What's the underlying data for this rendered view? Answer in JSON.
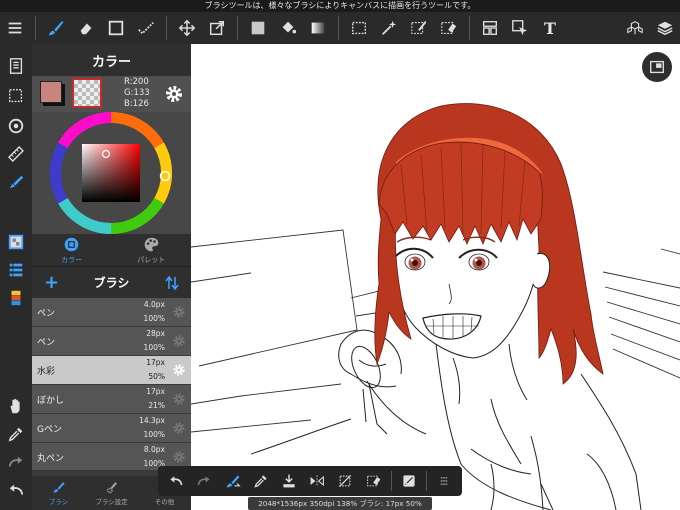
{
  "status_message": "ブラシツールは、様々なブラシによりキャンバスに描画を行うツールです。",
  "toolbar": {
    "left_tools": [
      "menu-icon",
      "brush-icon",
      "eraser-icon",
      "rectangle-icon",
      "dot-brush-icon"
    ],
    "mid_tools": [
      "move-icon",
      "transform-icon",
      "fill-swatch-icon",
      "bucket-icon",
      "gradient-icon"
    ],
    "select_tools": [
      "rect-select-icon",
      "magic-wand-icon",
      "select-pen-icon",
      "select-eraser-icon",
      "frame-icon",
      "pointer-icon",
      "text-icon"
    ],
    "text_tool_label": "T",
    "right_tools": [
      "3d-icon",
      "layers-icon"
    ]
  },
  "color_panel": {
    "title": "カラー",
    "rgb": {
      "r": "R:200",
      "g": "G:133",
      "b": "B:126"
    },
    "main_color": "#c8857e",
    "mode_tabs": [
      {
        "label": "カラー",
        "active": true
      },
      {
        "label": "パレット",
        "active": false
      }
    ]
  },
  "brush_panel": {
    "title": "ブラシ",
    "add_label": "+",
    "items": [
      {
        "name": "ペン",
        "size": "4.0px",
        "opacity": "100%",
        "selected": false
      },
      {
        "name": "ペン",
        "size": "28px",
        "opacity": "100%",
        "selected": false
      },
      {
        "name": "水彩",
        "size": "17px",
        "opacity": "50%",
        "selected": true
      },
      {
        "name": "ぼかし",
        "size": "17px",
        "opacity": "21%",
        "selected": false
      },
      {
        "name": "Gペン",
        "size": "14.3px",
        "opacity": "100%",
        "selected": false
      },
      {
        "name": "丸ペン",
        "size": "8.0px",
        "opacity": "100%",
        "selected": false
      }
    ]
  },
  "bottom_tabs": [
    {
      "label": "ブラシ",
      "active": true
    },
    {
      "label": "ブラシ設定",
      "active": false
    },
    {
      "label": "その他",
      "active": false
    }
  ],
  "canvas_status": "2048*1536px 350dpi 138% ブラシ: 17px 50%",
  "colors": {
    "accent": "#3ea3ff",
    "hair": "#b9361f",
    "panel_bg": "#3a3a3a",
    "toolbar_bg": "#2a2a2a"
  }
}
